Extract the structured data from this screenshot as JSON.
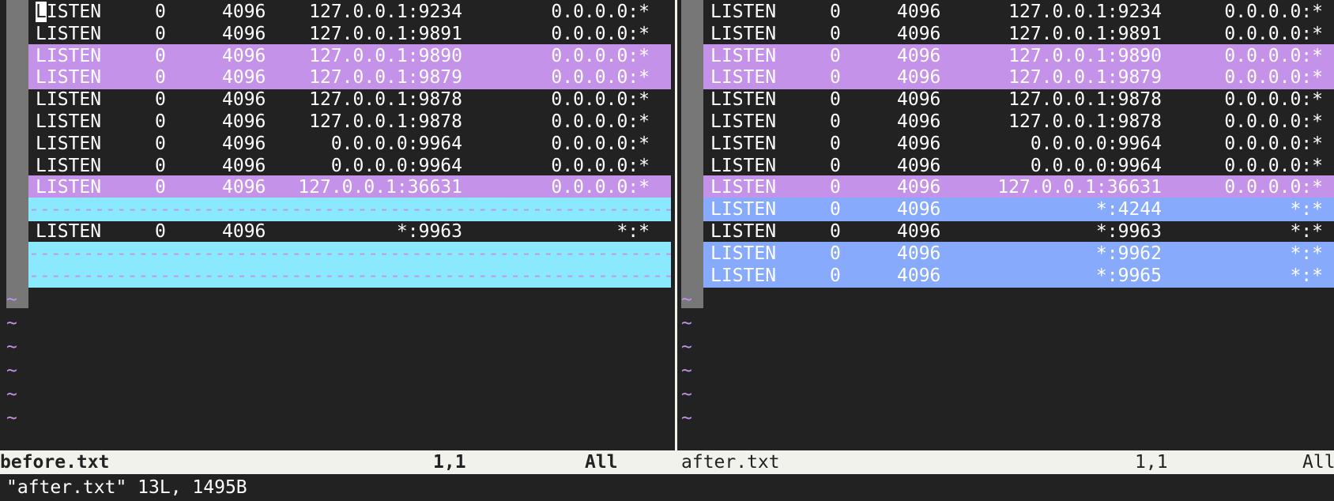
{
  "left": {
    "rows": [
      {
        "state": "LISTEN",
        "recv": "0",
        "send": "4096",
        "local": "127.0.0.1:9234",
        "peer": "0.0.0.0:*",
        "kind": "normal"
      },
      {
        "state": "LISTEN",
        "recv": "0",
        "send": "4096",
        "local": "127.0.0.1:9891",
        "peer": "0.0.0.0:*",
        "kind": "normal"
      },
      {
        "state": "LISTEN",
        "recv": "0",
        "send": "4096",
        "local": "127.0.0.1:9890",
        "peer": "0.0.0.0:*",
        "kind": "change"
      },
      {
        "state": "LISTEN",
        "recv": "0",
        "send": "4096",
        "local": "127.0.0.1:9879",
        "peer": "0.0.0.0:*",
        "kind": "change"
      },
      {
        "state": "LISTEN",
        "recv": "0",
        "send": "4096",
        "local": "127.0.0.1:9878",
        "peer": "0.0.0.0:*",
        "kind": "normal"
      },
      {
        "state": "LISTEN",
        "recv": "0",
        "send": "4096",
        "local": "127.0.0.1:9878",
        "peer": "0.0.0.0:*",
        "kind": "normal"
      },
      {
        "state": "LISTEN",
        "recv": "0",
        "send": "4096",
        "local": "0.0.0.0:9964",
        "peer": "0.0.0.0:*",
        "kind": "normal"
      },
      {
        "state": "LISTEN",
        "recv": "0",
        "send": "4096",
        "local": "0.0.0.0:9964",
        "peer": "0.0.0.0:*",
        "kind": "normal"
      },
      {
        "state": "LISTEN",
        "recv": "0",
        "send": "4096",
        "local": "127.0.0.1:36631",
        "peer": "0.0.0.0:*",
        "kind": "change"
      },
      {
        "kind": "filler"
      },
      {
        "state": "LISTEN",
        "recv": "0",
        "send": "4096",
        "local": "*:9963",
        "peer": "*:*",
        "kind": "normal"
      },
      {
        "kind": "filler"
      },
      {
        "kind": "filler"
      }
    ]
  },
  "right": {
    "rows": [
      {
        "state": "LISTEN",
        "recv": "0",
        "send": "4096",
        "local": "127.0.0.1:9234",
        "peer": "0.0.0.0:*",
        "kind": "normal"
      },
      {
        "state": "LISTEN",
        "recv": "0",
        "send": "4096",
        "local": "127.0.0.1:9891",
        "peer": "0.0.0.0:*",
        "kind": "normal"
      },
      {
        "state": "LISTEN",
        "recv": "0",
        "send": "4096",
        "local": "127.0.0.1:9890",
        "peer": "0.0.0.0:*",
        "kind": "change"
      },
      {
        "state": "LISTEN",
        "recv": "0",
        "send": "4096",
        "local": "127.0.0.1:9879",
        "peer": "0.0.0.0:*",
        "kind": "change"
      },
      {
        "state": "LISTEN",
        "recv": "0",
        "send": "4096",
        "local": "127.0.0.1:9878",
        "peer": "0.0.0.0:*",
        "kind": "normal"
      },
      {
        "state": "LISTEN",
        "recv": "0",
        "send": "4096",
        "local": "127.0.0.1:9878",
        "peer": "0.0.0.0:*",
        "kind": "normal"
      },
      {
        "state": "LISTEN",
        "recv": "0",
        "send": "4096",
        "local": "0.0.0.0:9964",
        "peer": "0.0.0.0:*",
        "kind": "normal"
      },
      {
        "state": "LISTEN",
        "recv": "0",
        "send": "4096",
        "local": "0.0.0.0:9964",
        "peer": "0.0.0.0:*",
        "kind": "normal"
      },
      {
        "state": "LISTEN",
        "recv": "0",
        "send": "4096",
        "local": "127.0.0.1:36631",
        "peer": "0.0.0.0:*",
        "kind": "change"
      },
      {
        "state": "LISTEN",
        "recv": "0",
        "send": "4096",
        "local": "*:4244",
        "peer": "*:*",
        "kind": "add"
      },
      {
        "state": "LISTEN",
        "recv": "0",
        "send": "4096",
        "local": "*:9963",
        "peer": "*:*",
        "kind": "normal"
      },
      {
        "state": "LISTEN",
        "recv": "0",
        "send": "4096",
        "local": "*:9962",
        "peer": "*:*",
        "kind": "add"
      },
      {
        "state": "LISTEN",
        "recv": "0",
        "send": "4096",
        "local": "*:9965",
        "peer": "*:*",
        "kind": "add"
      }
    ]
  },
  "tilde_char": "~",
  "tilde_rows": 6,
  "status_left": {
    "filename": "before.txt",
    "position": "1,1",
    "scroll": "All"
  },
  "status_right": {
    "filename": "after.txt",
    "position": "1,1",
    "scroll": "All"
  },
  "command_line": "\"after.txt\" 13L, 1495B",
  "colors": {
    "background": "#222222",
    "text": "#ffffff",
    "diff_change": "#c592e9",
    "diff_add": "#87aafc",
    "diff_filler": "#8be9fd",
    "tilde": "#c592e9",
    "status_bar": "#f2f2ec",
    "fold_column": "#777777"
  }
}
